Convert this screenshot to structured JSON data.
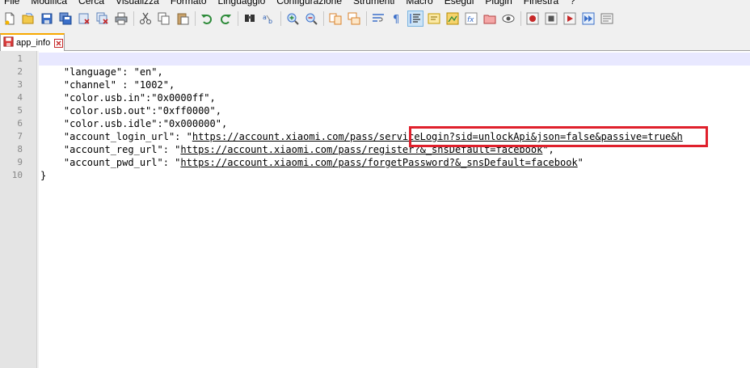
{
  "menu": {
    "items": [
      "File",
      "Modifica",
      "Cerca",
      "Visualizza",
      "Formato",
      "Linguaggio",
      "Configurazione",
      "Strumenti",
      "Macro",
      "Esegui",
      "Plugin",
      "Finestra",
      "?"
    ]
  },
  "toolbar": {
    "icons": [
      "new-file-icon",
      "open-file-icon",
      "save-icon",
      "save-all-icon",
      "close-icon",
      "close-all-icon",
      "print-icon",
      "cut-icon",
      "copy-icon",
      "paste-icon",
      "undo-icon",
      "redo-icon",
      "find-icon",
      "replace-icon",
      "zoom-in-icon",
      "zoom-out-icon",
      "sync-vertical-icon",
      "sync-horizontal-icon",
      "word-wrap-icon",
      "show-all-chars-icon",
      "indent-guide-icon",
      "udl-icon",
      "doc-map-icon",
      "function-list-icon",
      "folder-workspace-icon",
      "monitoring-icon",
      "record-macro-icon",
      "stop-macro-icon",
      "play-macro-icon",
      "run-macro-multiple-icon",
      "save-macro-icon"
    ]
  },
  "tabs": [
    {
      "label": "app_info",
      "active": true
    }
  ],
  "editor": {
    "current_line": 1,
    "lines": [
      {
        "num": "1",
        "text": ""
      },
      {
        "num": "2",
        "text": "    \"language\": \"en\","
      },
      {
        "num": "3",
        "text": "    \"channel\" : \"1002\","
      },
      {
        "num": "4",
        "text": "    \"color.usb.in\":\"0x0000ff\","
      },
      {
        "num": "5",
        "text": "    \"color.usb.out\":\"0xff0000\","
      },
      {
        "num": "6",
        "text": "    \"color.usb.idle\":\"0x000000\","
      },
      {
        "num": "7",
        "prefix": "    \"account_login_url\": \"",
        "link": "https://account.xiaomi.com/pass/serviceLogin?sid=unlockApi&json=false&passive=true&h",
        "suffix": ""
      },
      {
        "num": "8",
        "prefix": "    \"account_reg_url\": \"",
        "link": "https://account.xiaomi.com/pass/register?&_snsDefault=facebook",
        "suffix": "\","
      },
      {
        "num": "9",
        "prefix": "    \"account_pwd_url\": \"",
        "link": "https://account.xiaomi.com/pass/forgetPassword?&_snsDefault=facebook",
        "suffix": "\""
      },
      {
        "num": "10",
        "text": "}"
      }
    ]
  },
  "annotation": {
    "color": "#e0202c"
  }
}
